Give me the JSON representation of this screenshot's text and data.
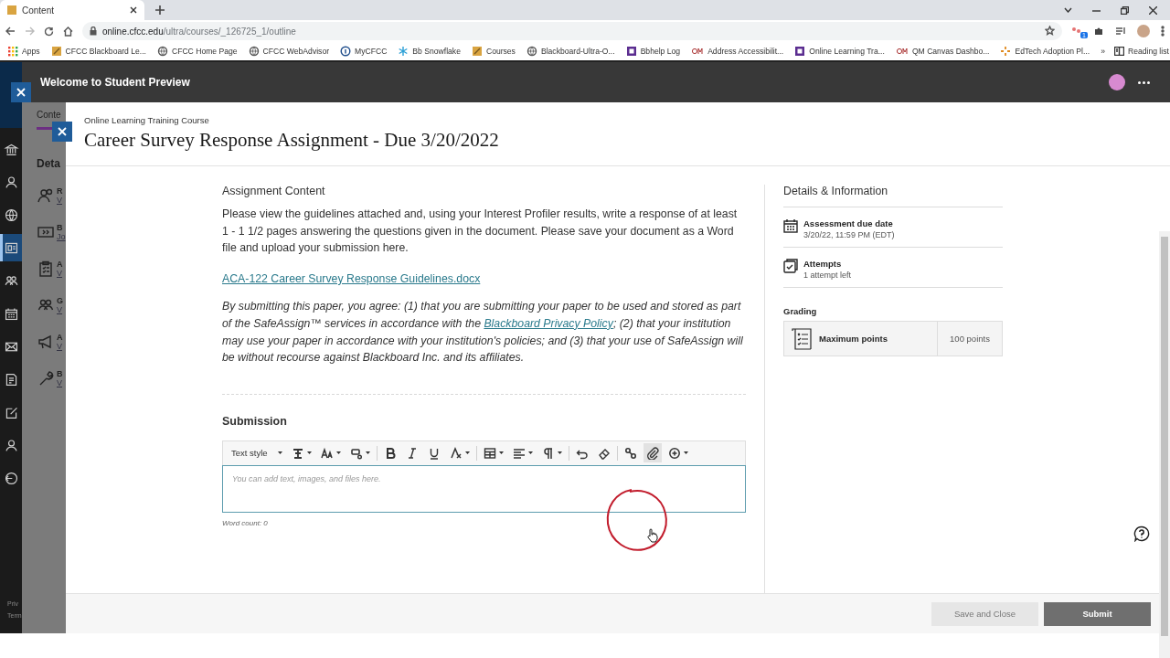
{
  "browser": {
    "tab": {
      "title": "Content"
    },
    "url_host": "online.cfcc.edu",
    "url_path": "/ultra/courses/_126725_1/outline",
    "extension_badge": "1",
    "bookmarks": [
      {
        "label": "Apps",
        "kind": "apps"
      },
      {
        "label": "CFCC Blackboard Le...",
        "kind": "folder"
      },
      {
        "label": "CFCC Home Page",
        "kind": "globe"
      },
      {
        "label": "CFCC WebAdvisor",
        "kind": "globe"
      },
      {
        "label": "MyCFCC",
        "kind": "info"
      },
      {
        "label": "Bb Snowflake",
        "kind": "snow"
      },
      {
        "label": "Courses",
        "kind": "folder"
      },
      {
        "label": "Blackboard-Ultra-O...",
        "kind": "globe"
      },
      {
        "label": "Bbhelp Log",
        "kind": "square"
      },
      {
        "label": "Address Accessibilit...",
        "kind": "qm"
      },
      {
        "label": "Online Learning Tra...",
        "kind": "square"
      },
      {
        "label": "QM Canvas Dashbo...",
        "kind": "qm"
      },
      {
        "label": "EdTech Adoption Pl...",
        "kind": "spark"
      }
    ],
    "overflow": "»",
    "reading_list": "Reading list"
  },
  "preview_bar": {
    "title": "Welcome to Student Preview"
  },
  "nav": [
    {
      "kind": "institution",
      "selected": false
    },
    {
      "kind": "person",
      "selected": false
    },
    {
      "kind": "globe",
      "selected": false
    },
    {
      "kind": "courses",
      "selected": true
    },
    {
      "kind": "groups",
      "selected": false
    },
    {
      "kind": "calendar",
      "selected": false
    },
    {
      "kind": "mail",
      "selected": false
    },
    {
      "kind": "grades",
      "selected": false
    },
    {
      "kind": "edit",
      "selected": false
    },
    {
      "kind": "person",
      "selected": false
    },
    {
      "kind": "signout",
      "selected": false
    }
  ],
  "nav_footer": [
    "Priv",
    "Term"
  ],
  "course_page": {
    "tab": "Conte",
    "heading": "Deta",
    "items": [
      {
        "kind": "people",
        "title": "R",
        "sub": "V"
      },
      {
        "kind": "video",
        "title": "B",
        "sub": "Jo"
      },
      {
        "kind": "clipboard",
        "title": "A",
        "sub": "V"
      },
      {
        "kind": "groups",
        "title": "G",
        "sub": "V"
      },
      {
        "kind": "megaphone",
        "title": "A",
        "sub": "V"
      },
      {
        "kind": "wrench",
        "title": "B",
        "sub": "V"
      }
    ]
  },
  "panel": {
    "course": "Online Learning Training Course",
    "title": "Career Survey Response Assignment - Due 3/20/2022",
    "content_heading": "Assignment Content",
    "instructions": "Please view the guidelines attached and, using your Interest Profiler results, write a response of at least 1 - 1 1/2 pages answering the questions given in the document. Please save your document as a Word file and upload your submission here.",
    "attachment": "ACA-122 Career Survey Response Guidelines.docx",
    "agreement_before": "By submitting this paper, you agree: (1) that you are submitting your paper to be used and stored as part of the SafeAssign™ services in accordance with the",
    "agreement_link": "Blackboard Privacy Policy",
    "agreement_after": "; (2) that your institution may use your paper in accordance with your institution's policies; and (3) that your use of SafeAssign will be without recourse against Blackboard Inc. and its affiliates.",
    "submission": {
      "heading": "Submission",
      "placeholder": "You can add text, images, and files here.",
      "word_count": "Word count: 0",
      "toolbar": [
        {
          "kind": "text-style",
          "label": "Text style",
          "menu": true,
          "hovered": false
        },
        {
          "kind": "format",
          "menu": true,
          "hovered": false
        },
        {
          "kind": "font-size",
          "menu": true,
          "hovered": false
        },
        {
          "kind": "highlight",
          "menu": true,
          "hovered": false
        },
        {
          "kind": "bold",
          "menu": false,
          "hovered": false
        },
        {
          "kind": "italic",
          "menu": false,
          "hovered": false
        },
        {
          "kind": "underline",
          "menu": false,
          "hovered": false
        },
        {
          "kind": "clear-format",
          "menu": true,
          "hovered": false
        },
        {
          "kind": "table",
          "menu": true,
          "hovered": false
        },
        {
          "kind": "align",
          "menu": true,
          "hovered": false
        },
        {
          "kind": "paragraph",
          "menu": true,
          "hovered": false
        },
        {
          "kind": "undo",
          "menu": false,
          "hovered": false
        },
        {
          "kind": "eraser",
          "menu": false,
          "hovered": false
        },
        {
          "kind": "link",
          "menu": false,
          "hovered": false
        },
        {
          "kind": "attach",
          "menu": false,
          "hovered": true
        },
        {
          "kind": "insert",
          "menu": true,
          "hovered": false
        }
      ]
    },
    "details": {
      "heading": "Details & Information",
      "items": [
        {
          "kind": "due",
          "label": "Assessment due date",
          "value": "3/20/22, 11:59 PM (EDT)"
        },
        {
          "kind": "attempts",
          "label": "Attempts",
          "value": "1 attempt left"
        }
      ],
      "grading_heading": "Grading",
      "grading_label": "Maximum points",
      "grading_value": "100 points"
    },
    "buttons": [
      {
        "kind": "secondary",
        "label": "Save and Close"
      },
      {
        "kind": "primary",
        "label": "Submit"
      }
    ]
  }
}
